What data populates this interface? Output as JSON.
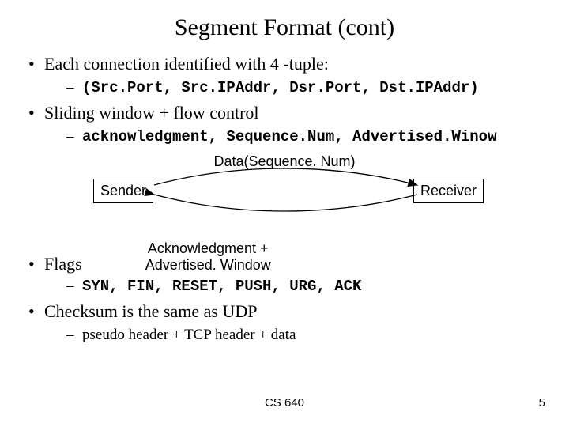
{
  "title": "Segment Format (cont)",
  "bullets": {
    "b1": "Each connection identified with 4 -tuple:",
    "b1_sub": "(Src.Port, Src.IPAddr, Dsr.Port, Dst.IPAddr)",
    "b2": "Sliding window + flow control",
    "b2_sub": "acknowledgment, Sequence.Num, Advertised.Winow",
    "b3": "Flags",
    "b3_sub": "SYN, FIN, RESET, PUSH, URG, ACK",
    "b4": "Checksum is the same as UDP",
    "b4_sub": "pseudo header + TCP header + data"
  },
  "diagram": {
    "top_label": "Data(Sequence. Num)",
    "sender": "Sender",
    "receiver": "Receiver",
    "bottom_label_l1": "Acknowledgment +",
    "bottom_label_l2": "Advertised. Window"
  },
  "footer": {
    "center": "CS 640",
    "page": "5"
  }
}
